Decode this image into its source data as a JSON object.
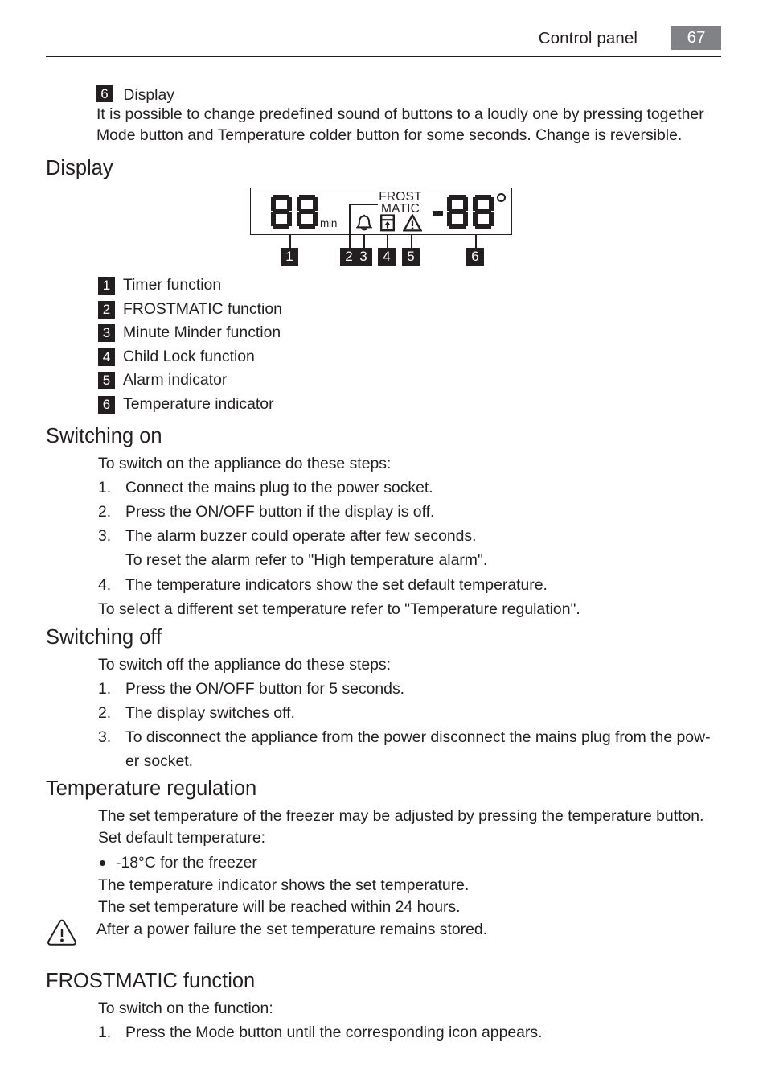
{
  "header": {
    "title": "Control panel",
    "page_number": "67",
    "page_box_color": "#808285"
  },
  "intro": {
    "chip": "6",
    "chip_label": "Display",
    "lines": [
      "It is possible to change predefined sound of buttons to a loudly one by pressing together",
      "Mode button and Temperature colder button for some seconds. Change is reversible."
    ]
  },
  "display_section": {
    "heading": "Display",
    "lcd": {
      "timer_value": "88",
      "timer_unit": "min",
      "frostmatic_line1": "FROST",
      "frostmatic_line2": "MATIC",
      "temperature_sign": "-",
      "temperature_value": "88",
      "temperature_degree": "°",
      "icons": [
        {
          "name": "bell-icon",
          "meaning": "Minute Minder"
        },
        {
          "name": "child-lock-icon",
          "meaning": "Child Lock"
        },
        {
          "name": "warning-triangle-icon",
          "meaning": "Alarm"
        }
      ]
    },
    "callouts": [
      "1",
      "2",
      "3",
      "4",
      "5",
      "6"
    ],
    "legend": [
      {
        "num": "1",
        "label": "Timer function"
      },
      {
        "num": "2",
        "label": "FROSTMATIC function"
      },
      {
        "num": "3",
        "label": "Minute Minder function"
      },
      {
        "num": "4",
        "label": "Child Lock function"
      },
      {
        "num": "5",
        "label": "Alarm indicator"
      },
      {
        "num": "6",
        "label": "Temperature indicator"
      }
    ]
  },
  "switching_on": {
    "heading": "Switching on",
    "intro": "To switch on the appliance do these steps:",
    "steps": [
      {
        "num": "1.",
        "text": "Connect the mains plug to the power socket."
      },
      {
        "num": "2.",
        "text": "Press the ON/OFF button if the display is off."
      },
      {
        "num": "3.",
        "text": "The alarm buzzer could operate after few seconds."
      }
    ],
    "step3_note": "To reset the alarm refer to \"High temperature alarm\".",
    "step4": {
      "num": "4.",
      "text": "The temperature indicators show the set default temperature."
    },
    "closing": "To select a different set temperature refer to \"Temperature regulation\"."
  },
  "switching_off": {
    "heading": "Switching off",
    "intro": "To switch off the appliance do these steps:",
    "steps": [
      {
        "num": "1.",
        "text": "Press the ON/OFF button for 5 seconds."
      },
      {
        "num": "2.",
        "text": "The display switches off."
      },
      {
        "num": "3.",
        "text": "To disconnect the appliance from the power disconnect the mains plug from the pow-"
      }
    ],
    "step3_wrap": "er socket."
  },
  "temperature_regulation": {
    "heading": "Temperature regulation",
    "line1": "The set temperature of the freezer may be adjusted by pressing the temperature button.",
    "line2": "Set default temperature:",
    "bullet": "-18°C for the freezer",
    "line3": "The temperature indicator shows the set temperature.",
    "line4": "The set temperature will be reached within 24 hours."
  },
  "caution": {
    "text": "After a power failure the set temperature remains stored."
  },
  "frostmatic_function": {
    "heading": "FROSTMATIC function",
    "intro": "To switch on the function:",
    "steps": [
      {
        "num": "1.",
        "text": "Press the Mode button until the corresponding icon appears."
      }
    ]
  }
}
